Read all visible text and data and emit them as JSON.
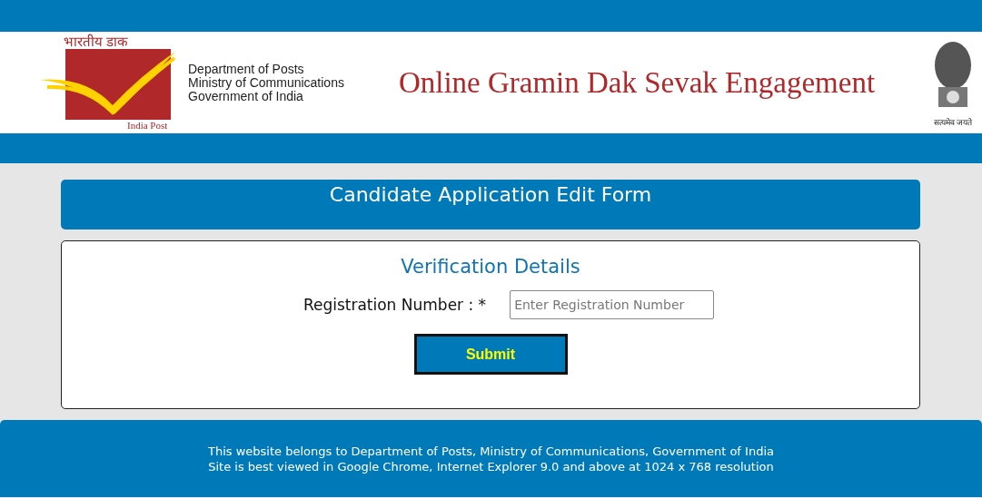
{
  "header": {
    "logo_hindi": "भारतीय डाक",
    "logo_caption": "India Post",
    "org_lines": [
      "Department of Posts",
      "Ministry of Communications",
      "Government of India"
    ],
    "title": "Online Gramin Dak Sevak Engagement",
    "emblem_motto": "सत्यमेव जयते"
  },
  "page_title": "Candidate Application Edit Form",
  "form": {
    "heading": "Verification Details",
    "label": "Registration Number : *",
    "placeholder": "Enter Registration Number",
    "submit": "Submit"
  },
  "footer": [
    "This website belongs to Department of Posts, Ministry of Communications, Government of India",
    "Site is best viewed in Google Chrome, Internet Explorer 9.0 and above at 1024 x 768 resolution"
  ]
}
